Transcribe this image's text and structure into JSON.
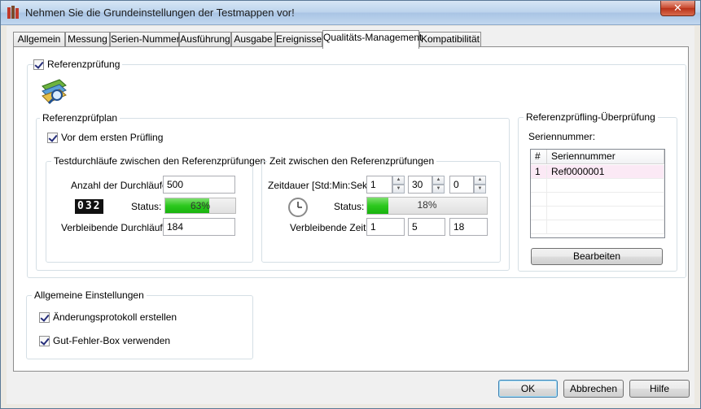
{
  "window": {
    "title": "Nehmen Sie die Grundeinstellungen der Testmappen vor!",
    "close_glyph": "✕"
  },
  "tabs": [
    "Allgemein",
    "Messung",
    "Serien-Nummer",
    "Ausführung",
    "Ausgabe",
    "Ereignisse",
    "Qualitäts-Management",
    "Kompatibilität"
  ],
  "active_tab": "Qualitäts-Management",
  "referenz": {
    "checkbox_label": "Referenzprüfung",
    "plan": {
      "title": "Referenzprüfplan",
      "first_check_label": "Vor dem ersten Prüfling",
      "runs_group": {
        "title": "Testdurchläufe zwischen den Referenzprüfungen",
        "count_label": "Anzahl der Durchläufe:",
        "count_value": "500",
        "counter_display": "032",
        "status_label": "Status:",
        "progress_percent": 63,
        "progress_text": "63%",
        "remaining_label": "Verbleibende Durchläufe:",
        "remaining_value": "184"
      },
      "time_group": {
        "title": "Zeit zwischen den Referenzprüfungen",
        "duration_label": "Zeitdauer [Std:Min:Sek]:",
        "hours": "1",
        "minutes": "30",
        "seconds": "0",
        "status_label": "Status:",
        "progress_percent": 18,
        "progress_text": "18%",
        "remaining_label": "Verbleibende Zeit:",
        "remaining_h": "1",
        "remaining_m": "5",
        "remaining_s": "18"
      }
    },
    "review": {
      "title": "Referenzprüfling-Überprüfung",
      "serial_label": "Seriennummer:",
      "columns": [
        "#",
        "Seriennummer"
      ],
      "rows": [
        {
          "num": "1",
          "serial": "Ref0000001"
        }
      ],
      "edit_button": "Bearbeiten"
    }
  },
  "general": {
    "title": "Allgemeine Einstellungen",
    "changelog_label": "Änderungsprotokoll erstellen",
    "passfail_label": "Gut-Fehler-Box verwenden"
  },
  "buttons": {
    "ok": "OK",
    "cancel": "Abbrechen",
    "help": "Hilfe"
  },
  "colors": {
    "progress_green": "#2cc81e",
    "selected_row": "#fbe9f5",
    "accent_border": "#3c7fb1"
  }
}
